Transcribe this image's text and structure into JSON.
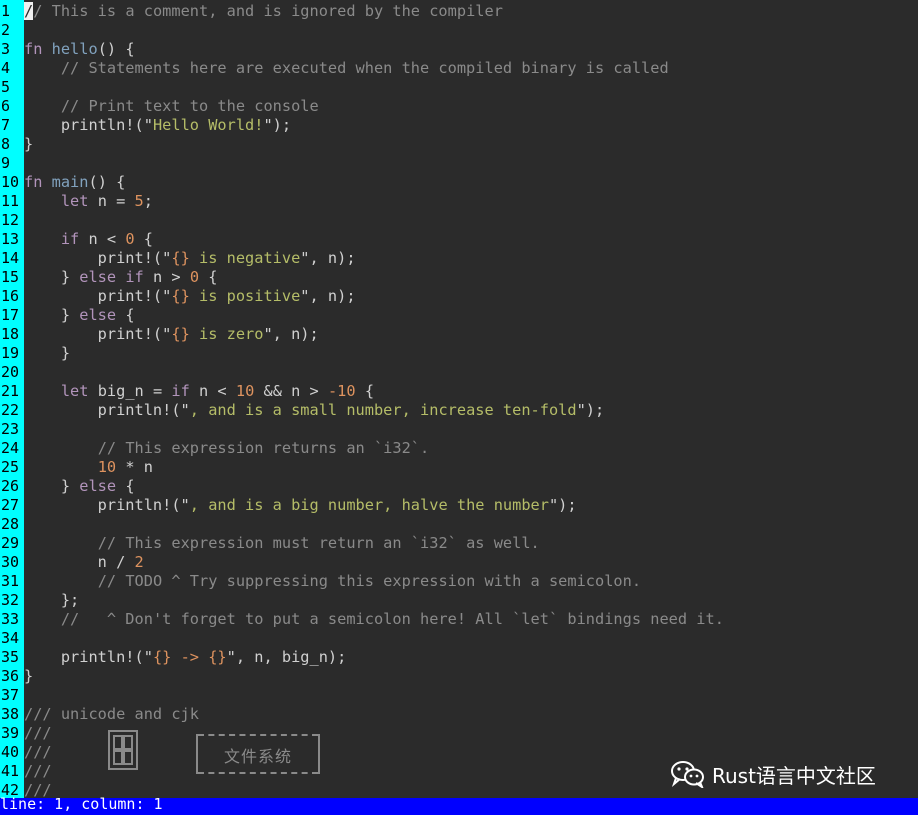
{
  "editor": {
    "lines": [
      {
        "n": "1",
        "tokens": [
          {
            "t": "/",
            "c": "cursor"
          },
          {
            "t": "/ This is a comment, and is ignored by the compiler",
            "c": "cmt"
          }
        ]
      },
      {
        "n": "2",
        "tokens": []
      },
      {
        "n": "3",
        "tokens": [
          {
            "t": "fn",
            "c": "kw"
          },
          {
            "t": " "
          },
          {
            "t": "hello",
            "c": "fnname"
          },
          {
            "t": "() {"
          }
        ]
      },
      {
        "n": "4",
        "tokens": [
          {
            "t": "    "
          },
          {
            "t": "// Statements here are executed when the compiled binary is called",
            "c": "cmt"
          }
        ]
      },
      {
        "n": "5",
        "tokens": []
      },
      {
        "n": "6",
        "tokens": [
          {
            "t": "    "
          },
          {
            "t": "// Print text to the console",
            "c": "cmt"
          }
        ]
      },
      {
        "n": "7",
        "tokens": [
          {
            "t": "    println!(\""
          },
          {
            "t": "Hello World!",
            "c": "str"
          },
          {
            "t": "\");"
          }
        ]
      },
      {
        "n": "8",
        "tokens": [
          {
            "t": "}"
          }
        ]
      },
      {
        "n": "9",
        "tokens": []
      },
      {
        "n": "10",
        "tokens": [
          {
            "t": "fn",
            "c": "kw"
          },
          {
            "t": " "
          },
          {
            "t": "main",
            "c": "fnname"
          },
          {
            "t": "() {"
          }
        ]
      },
      {
        "n": "11",
        "tokens": [
          {
            "t": "    "
          },
          {
            "t": "let",
            "c": "kw"
          },
          {
            "t": " n = "
          },
          {
            "t": "5",
            "c": "num"
          },
          {
            "t": ";"
          }
        ]
      },
      {
        "n": "12",
        "tokens": []
      },
      {
        "n": "13",
        "tokens": [
          {
            "t": "    "
          },
          {
            "t": "if",
            "c": "kw"
          },
          {
            "t": " n < "
          },
          {
            "t": "0",
            "c": "num"
          },
          {
            "t": " {"
          }
        ]
      },
      {
        "n": "14",
        "tokens": [
          {
            "t": "        print!(\""
          },
          {
            "t": "{}",
            "c": "fmt"
          },
          {
            "t": " is negative",
            "c": "str"
          },
          {
            "t": "\", n);"
          }
        ]
      },
      {
        "n": "15",
        "tokens": [
          {
            "t": "    } "
          },
          {
            "t": "else",
            "c": "kw"
          },
          {
            "t": " "
          },
          {
            "t": "if",
            "c": "kw"
          },
          {
            "t": " n > "
          },
          {
            "t": "0",
            "c": "num"
          },
          {
            "t": " {"
          }
        ]
      },
      {
        "n": "16",
        "tokens": [
          {
            "t": "        print!(\""
          },
          {
            "t": "{}",
            "c": "fmt"
          },
          {
            "t": " is positive",
            "c": "str"
          },
          {
            "t": "\", n);"
          }
        ]
      },
      {
        "n": "17",
        "tokens": [
          {
            "t": "    } "
          },
          {
            "t": "else",
            "c": "kw"
          },
          {
            "t": " {"
          }
        ]
      },
      {
        "n": "18",
        "tokens": [
          {
            "t": "        print!(\""
          },
          {
            "t": "{}",
            "c": "fmt"
          },
          {
            "t": " is zero",
            "c": "str"
          },
          {
            "t": "\", n);"
          }
        ]
      },
      {
        "n": "19",
        "tokens": [
          {
            "t": "    }"
          }
        ]
      },
      {
        "n": "20",
        "tokens": []
      },
      {
        "n": "21",
        "tokens": [
          {
            "t": "    "
          },
          {
            "t": "let",
            "c": "kw"
          },
          {
            "t": " big_n = "
          },
          {
            "t": "if",
            "c": "kw"
          },
          {
            "t": " n < "
          },
          {
            "t": "10",
            "c": "num"
          },
          {
            "t": " && n > "
          },
          {
            "t": "-10",
            "c": "num"
          },
          {
            "t": " {"
          }
        ]
      },
      {
        "n": "22",
        "tokens": [
          {
            "t": "        println!(\""
          },
          {
            "t": ", and is a small number, increase ten-fold",
            "c": "str"
          },
          {
            "t": "\");"
          }
        ]
      },
      {
        "n": "23",
        "tokens": []
      },
      {
        "n": "24",
        "tokens": [
          {
            "t": "        "
          },
          {
            "t": "// This expression returns an `i32`.",
            "c": "cmt"
          }
        ]
      },
      {
        "n": "25",
        "tokens": [
          {
            "t": "        "
          },
          {
            "t": "10",
            "c": "num"
          },
          {
            "t": " * n"
          }
        ]
      },
      {
        "n": "26",
        "tokens": [
          {
            "t": "    } "
          },
          {
            "t": "else",
            "c": "kw"
          },
          {
            "t": " {"
          }
        ]
      },
      {
        "n": "27",
        "tokens": [
          {
            "t": "        println!(\""
          },
          {
            "t": ", and is a big number, halve the number",
            "c": "str"
          },
          {
            "t": "\");"
          }
        ]
      },
      {
        "n": "28",
        "tokens": []
      },
      {
        "n": "29",
        "tokens": [
          {
            "t": "        "
          },
          {
            "t": "// This expression must return an `i32` as well.",
            "c": "cmt"
          }
        ]
      },
      {
        "n": "30",
        "tokens": [
          {
            "t": "        n / "
          },
          {
            "t": "2",
            "c": "num"
          }
        ]
      },
      {
        "n": "31",
        "tokens": [
          {
            "t": "        "
          },
          {
            "t": "// TODO ^ Try suppressing this expression with a semicolon.",
            "c": "cmt"
          }
        ]
      },
      {
        "n": "32",
        "tokens": [
          {
            "t": "    };"
          }
        ]
      },
      {
        "n": "33",
        "tokens": [
          {
            "t": "    "
          },
          {
            "t": "//   ^ Don't forget to put a semicolon here! All `let` bindings need it.",
            "c": "cmt"
          }
        ]
      },
      {
        "n": "34",
        "tokens": []
      },
      {
        "n": "35",
        "tokens": [
          {
            "t": "    println!(\""
          },
          {
            "t": "{} -> {}",
            "c": "fmt"
          },
          {
            "t": "\", n, big_n);"
          }
        ]
      },
      {
        "n": "36",
        "tokens": [
          {
            "t": "}"
          }
        ]
      },
      {
        "n": "37",
        "tokens": []
      },
      {
        "n": "38",
        "tokens": [
          {
            "t": "/// unicode and cjk",
            "c": "cmt"
          }
        ]
      },
      {
        "n": "39",
        "tokens": [
          {
            "t": "///",
            "c": "cmt"
          }
        ]
      },
      {
        "n": "40",
        "tokens": [
          {
            "t": "///",
            "c": "cmt"
          }
        ]
      },
      {
        "n": "41",
        "tokens": [
          {
            "t": "///",
            "c": "cmt"
          }
        ]
      },
      {
        "n": "42",
        "tokens": [
          {
            "t": "///",
            "c": "cmt"
          }
        ]
      }
    ],
    "cjk_box_label": "文件系统"
  },
  "watermark": {
    "text": "Rust语言中文社区",
    "icon": "wechat-icon"
  },
  "statusbar": {
    "text": "line: 1, column: 1"
  },
  "colors": {
    "gutter": "#00ffff",
    "background": "#2b2b2b",
    "statusbar": "#0000ff",
    "keyword": "#b294bb",
    "function": "#81a2be",
    "comment": "#8a8a8a",
    "string": "#b5bd68",
    "number": "#de935f"
  }
}
